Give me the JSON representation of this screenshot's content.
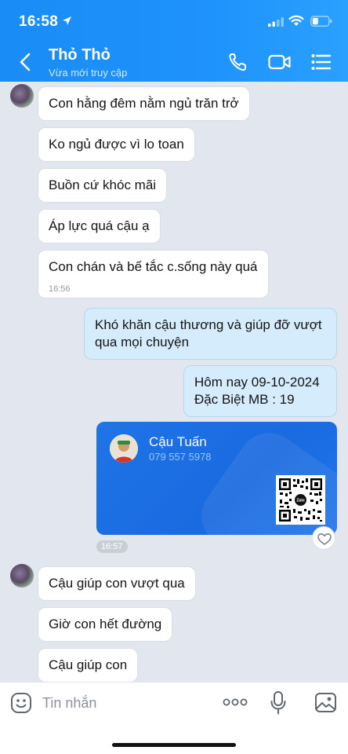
{
  "status_bar": {
    "time": "16:58"
  },
  "header": {
    "title": "Thỏ Thỏ",
    "subtitle": "Vừa mới truy cập"
  },
  "messages": [
    {
      "text": "Con hằng đêm nằm ngủ trăn trở"
    },
    {
      "text": "Ko ngủ được vì lo toan"
    },
    {
      "text": "Buồn cứ khóc mãi"
    },
    {
      "text": "Áp lực quá cậu ạ"
    },
    {
      "text": "Con chán và bế tắc c.sống này quá",
      "time": "16:56"
    },
    {
      "line1": "Khó khăn cậu thương và giúp đỡ vượt",
      "line2": "qua mọi chuyện"
    },
    {
      "line1": "Hôm nay 09-10-2024",
      "line2": "Đặc Biệt MB : 19"
    },
    {
      "text": "Cậu giúp con vượt qua"
    },
    {
      "text": "Giờ con hết đường"
    },
    {
      "text": "Cậu giúp con"
    }
  ],
  "contact_card": {
    "name": "Cậu Tuấn",
    "phone": "079 557 5978",
    "qr_logo": "Zalo",
    "time": "16:57"
  },
  "input": {
    "placeholder": "Tin nhắn"
  },
  "icons": {
    "back": "chevron-left-icon",
    "phone": "phone-icon",
    "video": "video-camera-icon",
    "menu": "list-menu-icon",
    "emoji": "emoji-sticker-icon",
    "more": "more-dots-icon",
    "mic": "microphone-icon",
    "image": "image-icon",
    "heart": "heart-icon"
  },
  "colors": {
    "header": "#1e93fb",
    "my_bubble": "#d5ecfc",
    "card": "#1f74e6",
    "background": "#e2e6ee"
  }
}
